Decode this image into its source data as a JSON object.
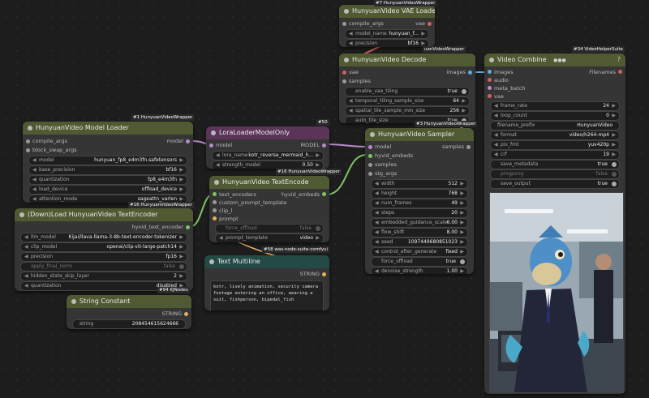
{
  "colors": {
    "olive": "#4f5a33",
    "purple": "#5b3558",
    "teal": "#244a46",
    "canvas": "#1d1d1d"
  },
  "badges": {
    "model_loader": "#1 HunyuanVideoWrapper",
    "lora": "#50",
    "vae_loader": "#7 HunyuanVideoWrapper",
    "decode": "uanVideoWrapper",
    "sampler": "#3 HunyuanVideoWrapper",
    "textencode": "#16 HunyuanVideoWrapper",
    "textload": "#16 HunyuanVideoWrapper",
    "multiline": "#58 was-node-suite-comfyui",
    "string_const": "#94 KJNodes",
    "combine": "#34 VideoHelperSuite"
  },
  "model_loader": {
    "title": "HunyuanVideo Model Loader",
    "inputs": [
      "compile_args",
      "block_swap_args"
    ],
    "output": "model",
    "widgets": [
      {
        "label": "model",
        "value": "hunyuan_fp8_e4m3fn.safetensors"
      },
      {
        "label": "base_precision",
        "value": "bf16"
      },
      {
        "label": "quantization",
        "value": "fp8_e4m3fn"
      },
      {
        "label": "load_device",
        "value": "offload_device"
      },
      {
        "label": "attention_mode",
        "value": "sageattn_varlen"
      }
    ]
  },
  "lora": {
    "title": "LoraLoaderModelOnly",
    "input": "model",
    "output": "MODEL",
    "widgets": [
      {
        "label": "lora_name",
        "value": "kotr_reverse_mermaid_h..."
      },
      {
        "label": "strength_model",
        "value": "0.50"
      }
    ]
  },
  "vae_loader": {
    "title": "HunyuanVideo VAE Loader",
    "input": "compile_args",
    "output": "vae",
    "widgets": [
      {
        "label": "model_name",
        "value": "hunyuan_f..."
      },
      {
        "label": "precision",
        "value": "bf16"
      }
    ]
  },
  "decode": {
    "title": "HunyuanVideo Decode",
    "inputs": [
      "vae",
      "samples"
    ],
    "output": "images",
    "widgets": [
      {
        "label": "enable_vae_tiling",
        "value": "true"
      },
      {
        "label": "temporal_tiling_sample_size",
        "value": "64"
      },
      {
        "label": "spatial_tile_sample_min_size",
        "value": "256"
      },
      {
        "label": "auto_tile_size",
        "value": "true"
      }
    ]
  },
  "sampler": {
    "title": "HunyuanVideo Sampler",
    "inputs": [
      "model",
      "hyvid_embeds",
      "samples",
      "stg_args"
    ],
    "output": "samples",
    "widgets": [
      {
        "label": "width",
        "value": "512"
      },
      {
        "label": "height",
        "value": "768"
      },
      {
        "label": "num_frames",
        "value": "49"
      },
      {
        "label": "steps",
        "value": "20"
      },
      {
        "label": "embedded_guidance_scale",
        "value": "6.00"
      },
      {
        "label": "flow_shift",
        "value": "8.00"
      },
      {
        "label": "seed",
        "value": "1097449680851023"
      },
      {
        "label": "control_after_generate",
        "value": "fixed"
      },
      {
        "label": "force_offload",
        "value": "true"
      },
      {
        "label": "denoise_strength",
        "value": "1.00"
      }
    ]
  },
  "textload": {
    "title": "(Down)Load HunyuanVideo TextEncoder",
    "output": "hyvid_text_encoder",
    "widgets": [
      {
        "label": "llm_model",
        "value": "Kijai/llava-llama-3-8b-text-encoder-tokenizer"
      },
      {
        "label": "clip_model",
        "value": "openai/clip-vit-large-patch14"
      },
      {
        "label": "precision",
        "value": "fp16"
      },
      {
        "label": "apply_final_norm",
        "value": "false"
      },
      {
        "label": "hidden_state_skip_layer",
        "value": "2"
      },
      {
        "label": "quantization",
        "value": "disabled"
      }
    ]
  },
  "textencode": {
    "title": "HunyuanVideo TextEncode",
    "inputs": [
      "text_encoders",
      "custom_prompt_template",
      "clip_l",
      "prompt"
    ],
    "output": "hyvid_embeds",
    "widgets": [
      {
        "label": "force_offload",
        "value": "false"
      },
      {
        "label": "prompt_template",
        "value": "video"
      }
    ]
  },
  "multiline": {
    "title": "Text Multiline",
    "output": "STRING",
    "text": "kotr, lively animation, security camera footage entering an office, wearing a suit, fishperson, bipedal_fish"
  },
  "string_const": {
    "title": "String Constant",
    "output": "STRING",
    "widget": {
      "label": "string",
      "value": "208454615624666"
    }
  },
  "combine": {
    "title": "Video Combine",
    "icon_text": "●●●",
    "corner": "?",
    "inputs": [
      "images",
      "audio",
      "meta_batch",
      "vae"
    ],
    "output": "Filenames",
    "widgets": [
      {
        "label": "frame_rate",
        "value": "24"
      },
      {
        "label": "loop_count",
        "value": "0"
      },
      {
        "label": "filename_prefix",
        "value": "HunyuanVideo"
      },
      {
        "label": "format",
        "value": "video/h264-mp4"
      },
      {
        "label": "pix_fmt",
        "value": "yuv420p"
      },
      {
        "label": "crf",
        "value": "19"
      },
      {
        "label": "save_metadata",
        "value": "true"
      },
      {
        "label": "pingpong",
        "value": "false"
      },
      {
        "label": "save_output",
        "value": "true"
      }
    ]
  }
}
